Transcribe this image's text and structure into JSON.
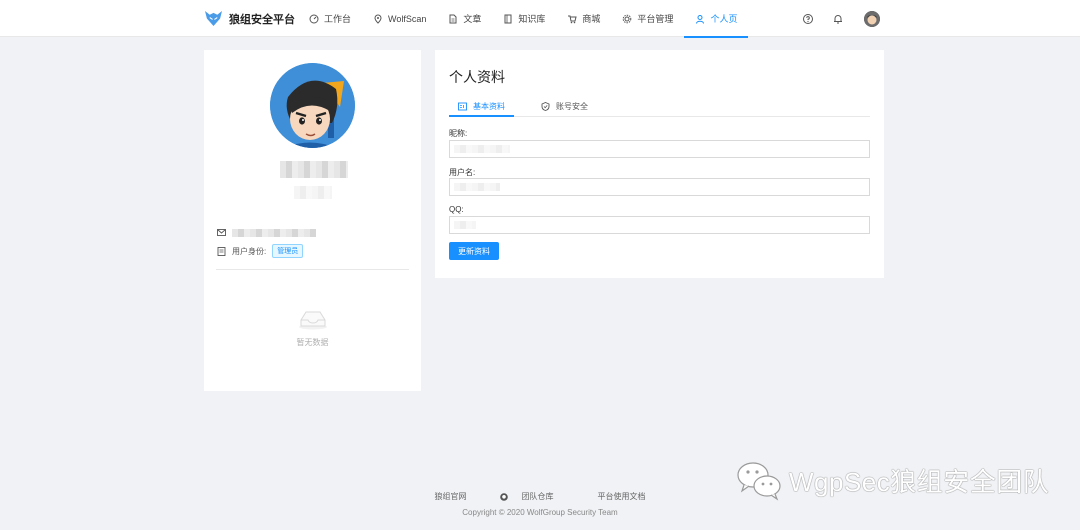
{
  "brand": {
    "name": "狼组安全平台"
  },
  "nav": [
    {
      "label": "工作台",
      "icon": "dashboard-icon"
    },
    {
      "label": "WolfScan",
      "icon": "location-icon"
    },
    {
      "label": "文章",
      "icon": "file-text-icon"
    },
    {
      "label": "知识库",
      "icon": "book-icon"
    },
    {
      "label": "商城",
      "icon": "cart-icon"
    },
    {
      "label": "平台管理",
      "icon": "gear-icon"
    },
    {
      "label": "个人页",
      "icon": "user-icon",
      "active": true
    }
  ],
  "header_icons": [
    "help-icon",
    "bell-icon",
    "avatar"
  ],
  "profile": {
    "role_label": "用户身份:",
    "role_tag": "管理员",
    "empty_text": "暂无数据"
  },
  "settings": {
    "title": "个人资料",
    "tabs": [
      {
        "label": "基本资料",
        "icon": "profile-card-icon",
        "active": true
      },
      {
        "label": "账号安全",
        "icon": "shield-icon"
      }
    ],
    "fields": [
      {
        "label": "昵称:"
      },
      {
        "label": "用户名:"
      },
      {
        "label": "QQ:"
      }
    ],
    "submit_label": "更新资料"
  },
  "footer": {
    "links": [
      "狼组官网",
      "团队仓库",
      "平台使用文档"
    ],
    "copyright": "Copyright © 2020 WolfGroup Security Team"
  },
  "watermark": {
    "text": "WgpSec狼组安全团队"
  },
  "colors": {
    "accent": "#1890ff",
    "background": "#f0f2f5"
  }
}
